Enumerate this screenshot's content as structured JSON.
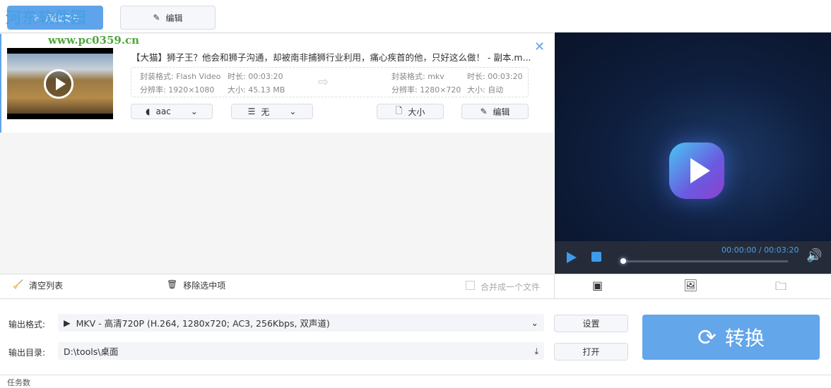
{
  "toolbar": {
    "add_file": "添加文件",
    "edit": "编辑"
  },
  "watermark": {
    "name": "河东软件园",
    "url": "www.pc0359.cn"
  },
  "file": {
    "title": "【大猫】狮子王？他会和狮子沟通，却被南非捕狮行业利用，痛心疾首的他，只好这么做！ - 副本.m...",
    "src_format_label": "封装格式:",
    "src_format": "Flash Video",
    "src_duration_label": "时长:",
    "src_duration": "00:03:20",
    "src_res_label": "分辨率:",
    "src_res": "1920×1080",
    "src_size_label": "大小:",
    "src_size": "45.13 MB",
    "dst_format": "mkv",
    "dst_duration": "00:03:20",
    "dst_res": "1280×720",
    "dst_size": "自动",
    "audio": "aac",
    "subtitle": "无",
    "size_btn": "大小",
    "edit_btn": "编辑"
  },
  "player": {
    "time": "00:00:00 / 00:03:20",
    "progress": 0
  },
  "listbar": {
    "clear": "清空列表",
    "remove": "移除选中项",
    "merge": "合并成一个文件"
  },
  "output": {
    "format_label": "输出格式:",
    "format": "MKV - 高清720P (H.264, 1280x720; AC3, 256Kbps, 双声道)",
    "dir_label": "输出目录:",
    "dir": "D:\\tools\\桌面",
    "settings": "设置",
    "open": "打开",
    "convert": "转换"
  },
  "status": {
    "tasks": "任务数"
  }
}
